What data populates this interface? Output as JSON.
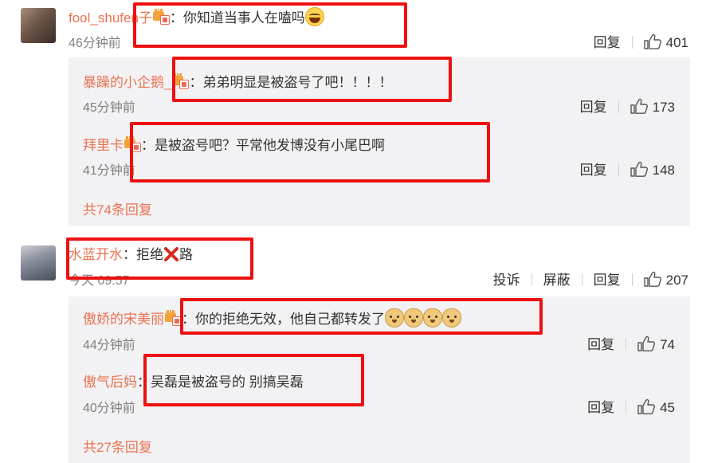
{
  "threads": [
    {
      "author": "fool_shufen子",
      "content": "：你知道当事人在嗑吗",
      "time": "46分钟前",
      "reply_label": "回复",
      "likes": "401",
      "replies": [
        {
          "author": "暴躁的小企鹅_",
          "content": "：弟弟明显是被盗号了吧！！！！",
          "time": "45分钟前",
          "reply_label": "回复",
          "likes": "173"
        },
        {
          "author": "拜里卡",
          "content": "：是被盗号吧？平常他发博没有小尾巴啊",
          "time": "41分钟前",
          "reply_label": "回复",
          "likes": "148"
        }
      ],
      "more_replies": "共74条回复"
    },
    {
      "author": "水蓝开水",
      "content_before": "：拒绝",
      "content_after": "路",
      "time": "今天 09:57",
      "report_label": "投诉",
      "block_label": "屏蔽",
      "reply_label": "回复",
      "likes": "207",
      "replies": [
        {
          "author": "傲娇的宋美丽",
          "content": "：你的拒绝无效，他自己都转发了",
          "time": "44分钟前",
          "reply_label": "回复",
          "likes": "74"
        },
        {
          "author": "傲气后妈",
          "content": "：吴磊是被盗号的 别搞吴磊",
          "time": "40分钟前",
          "reply_label": "回复",
          "likes": "45"
        }
      ],
      "more_replies": "共27条回复"
    }
  ],
  "icons": {
    "like": "thumbs-up-icon",
    "vip": "vip-crown-icon",
    "laugh": "laughing-emoji-icon",
    "doge": "doge-emoji-icon",
    "cross": "red-cross-emoji-icon"
  },
  "colors": {
    "username": "#eb7350",
    "highlight_box": "#ee1010",
    "reply_bg": "#f2f2f5"
  }
}
